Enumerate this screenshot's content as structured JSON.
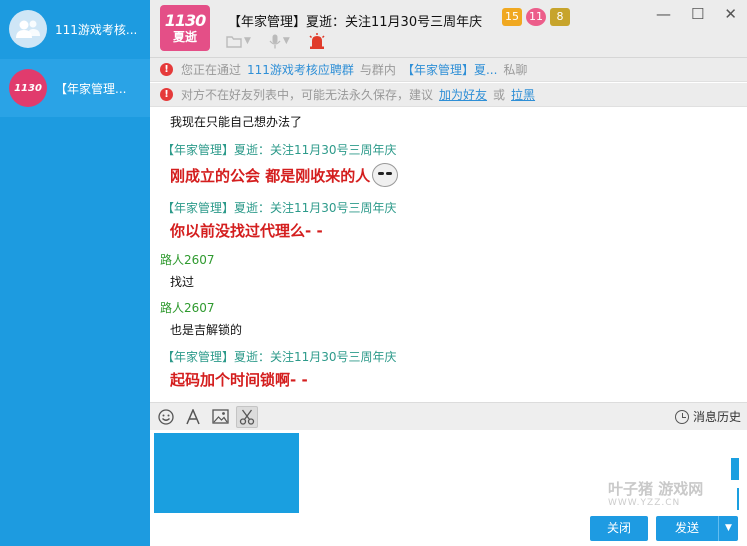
{
  "sidebar": {
    "items": [
      {
        "label": "111游戏考核...",
        "icon": "group-avatar-icon"
      },
      {
        "label": "【年家管理...",
        "icon": "user-avatar"
      }
    ]
  },
  "header": {
    "logo_line1": "1130",
    "logo_line2": "夏逝",
    "title": "【年家管理】夏逝：关注11月30号三周年庆",
    "badges": [
      "15",
      "11",
      "8"
    ],
    "window_buttons": {
      "minimize": "—",
      "maximize": "☐",
      "close": "✕"
    }
  },
  "notices": {
    "n1": {
      "prefix": "您正在通过",
      "group": "111游戏考核应聘群",
      "middle": "与群内",
      "member": "【年家管理】夏...",
      "suffix": "私聊"
    },
    "n2": {
      "text": "对方不在好友列表中，可能无法永久保存，建议",
      "add_friend": "加为好友",
      "or": "或",
      "block": "拉黑"
    }
  },
  "messages": [
    {
      "type": "text",
      "text": "我现在只能自己想办法了"
    },
    {
      "type": "admin",
      "sender": "【年家管理】夏逝：关注11月30号三周年庆"
    },
    {
      "type": "big",
      "text": "刚成立的公会 都是刚收来的人"
    },
    {
      "type": "admin",
      "sender": "【年家管理】夏逝：关注11月30号三周年庆"
    },
    {
      "type": "big",
      "text": "你以前没找过代理么- -"
    },
    {
      "type": "guest",
      "sender": "路人2607"
    },
    {
      "type": "text",
      "text": "找过"
    },
    {
      "type": "guest",
      "sender": "路人2607"
    },
    {
      "type": "text",
      "text": "也是吉解锁的"
    },
    {
      "type": "admin",
      "sender": "【年家管理】夏逝：关注11月30号三周年庆"
    },
    {
      "type": "big",
      "text": "起码加个时间锁啊- -"
    }
  ],
  "input_toolbar": {
    "history_label": "消息历史"
  },
  "watermark": {
    "main": "叶子猪 游戏网",
    "sub": "WWW.YZZ.CN"
  },
  "buttons": {
    "close": "关闭",
    "send": "发送"
  },
  "colors": {
    "sidebar": "#1d9be0",
    "accent": "#1e9be2",
    "admin_sender": "#2c9a8a",
    "guest_sender": "#2f9a2f",
    "emphasis": "#d41e1e"
  }
}
